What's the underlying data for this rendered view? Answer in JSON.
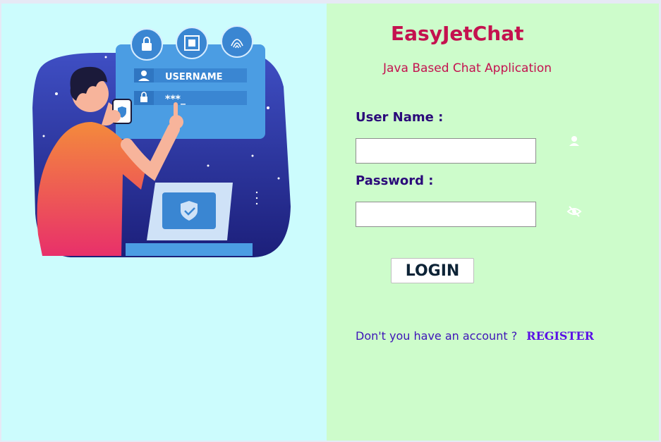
{
  "illustration": {
    "username_label": "USERNAME",
    "password_mask": "***_"
  },
  "app": {
    "title": "EasyJetChat",
    "subtitle": "Java Based Chat Application"
  },
  "form": {
    "username_label": "User Name :",
    "username_value": "",
    "username_icon": "user-icon",
    "password_label": "Password :",
    "password_value": "",
    "password_icon": "eye-slash-icon",
    "login_label": "LOGIN"
  },
  "footer": {
    "prompt": "Don't you have an account ?",
    "register_label": "REGISTER"
  },
  "colors": {
    "left_bg": "#ccfcfd",
    "right_bg": "#cdfccb",
    "title": "#c4114f",
    "label": "#2b0a7a",
    "link": "#5a10e6"
  }
}
